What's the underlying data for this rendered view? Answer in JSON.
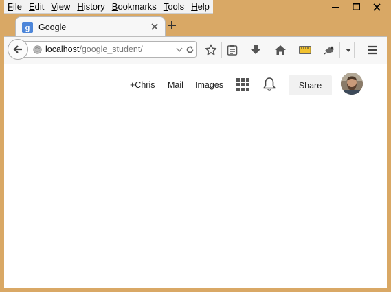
{
  "menubar": {
    "items": [
      {
        "label": "File"
      },
      {
        "label": "Edit"
      },
      {
        "label": "View"
      },
      {
        "label": "History"
      },
      {
        "label": "Bookmarks"
      },
      {
        "label": "Tools"
      },
      {
        "label": "Help"
      }
    ]
  },
  "tab": {
    "title": "Google",
    "favicon": "google-g-icon"
  },
  "urlbar": {
    "host": "localhost",
    "path": "/google_student/"
  },
  "toolbar_icons": [
    "back-icon",
    "globe-icon",
    "url-dropdown-icon",
    "reload-icon",
    "bookmark-star-icon",
    "reading-list-icon",
    "download-icon",
    "home-icon",
    "ruler-icon",
    "extension-icon",
    "overflow-chevron-icon",
    "hamburger-menu-icon"
  ],
  "google_bar": {
    "plus_user": "+Chris",
    "mail": "Mail",
    "images": "Images",
    "share": "Share",
    "apps_icon": "apps-grid-icon",
    "notifications_icon": "bell-icon"
  },
  "colors": {
    "window_frame": "#d9a865",
    "close_button": "#c9463d",
    "favicon_blue": "#4d86d9",
    "share_bg": "#f1f1f1"
  }
}
